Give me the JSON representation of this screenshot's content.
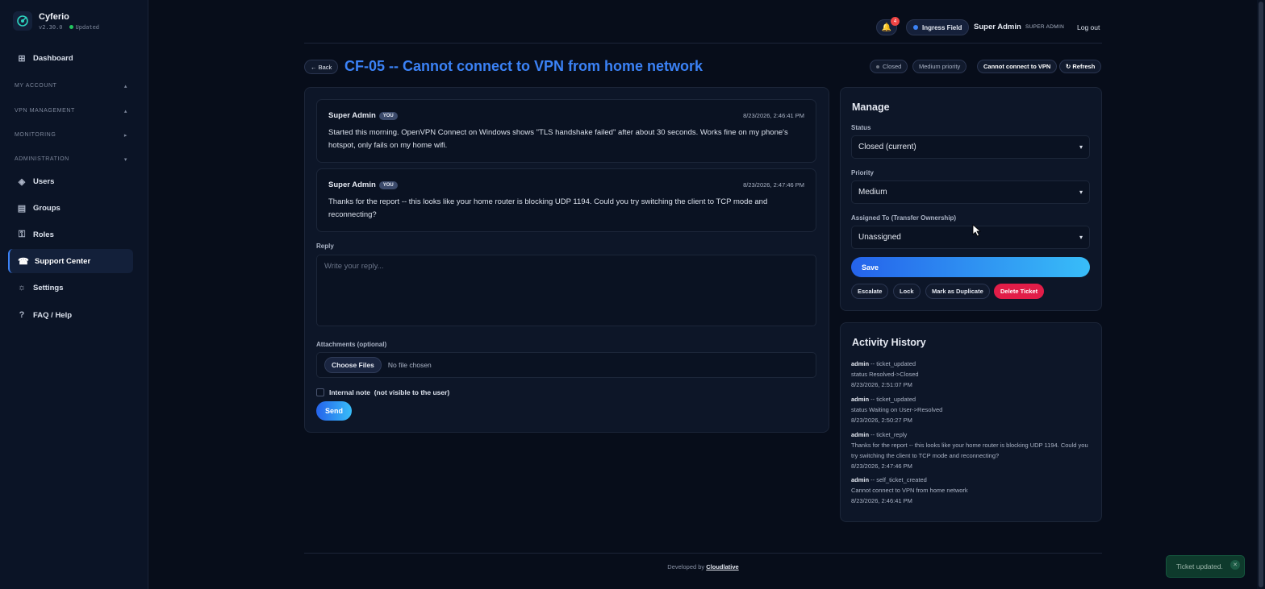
{
  "app": {
    "name": "Cyferio",
    "version": "v2.30.0",
    "status": "Updated"
  },
  "sidebar": {
    "dashboard": "Dashboard",
    "sections": {
      "my_account": "MY ACCOUNT",
      "vpn_management": "VPN MANAGEMENT",
      "monitoring": "MONITORING",
      "administration": "ADMINISTRATION"
    },
    "items": {
      "users": "Users",
      "groups": "Groups",
      "roles": "Roles",
      "support_center": "Support Center",
      "settings": "Settings",
      "faq": "FAQ / Help"
    }
  },
  "topbar": {
    "notification_count": "4",
    "workspace": "Ingress Field",
    "user_name": "Super Admin",
    "user_role": "SUPER ADMIN",
    "logout": "Log out"
  },
  "ticket": {
    "back_label": "← Back",
    "title": "CF-05 -- Cannot connect to VPN from home network",
    "pills": {
      "status": "Closed",
      "priority": "Medium priority",
      "subject": "Cannot connect to VPN",
      "refresh": "↻ Refresh"
    },
    "messages": [
      {
        "author": "Super Admin",
        "badge": "YOU",
        "time": "8/23/2026, 2:46:41 PM",
        "body": "Started this morning. OpenVPN Connect on Windows shows \"TLS handshake failed\" after about 30 seconds. Works fine on my phone's hotspot, only fails on my home wifi."
      },
      {
        "author": "Super Admin",
        "badge": "YOU",
        "time": "8/23/2026, 2:47:46 PM",
        "body": "Thanks for the report -- this looks like your home router is blocking UDP 1194. Could you try switching the client to TCP mode and reconnecting?"
      }
    ],
    "reply": {
      "label": "Reply",
      "placeholder": "Write your reply...",
      "attachments_label": "Attachments (optional)",
      "choose_files": "Choose Files",
      "no_file": "No file chosen",
      "internal_note": "Internal note  (not visible to the user)",
      "send": "Send"
    }
  },
  "manage": {
    "title": "Manage",
    "status_label": "Status",
    "status_value": "Closed (current)",
    "priority_label": "Priority",
    "priority_value": "Medium",
    "assigned_label": "Assigned To (Transfer Ownership)",
    "assigned_value": "Unassigned",
    "save": "Save",
    "actions": {
      "escalate": "Escalate",
      "lock": "Lock",
      "duplicate": "Mark as Duplicate",
      "delete": "Delete Ticket"
    }
  },
  "activity": {
    "title": "Activity History",
    "entries": [
      {
        "who": "admin",
        "action": " -- ticket_updated",
        "detail": "status Resolved->Closed",
        "time": "8/23/2026, 2:51:07 PM"
      },
      {
        "who": "admin",
        "action": " -- ticket_updated",
        "detail": "status Waiting on User->Resolved",
        "time": "8/23/2026, 2:50:27 PM"
      },
      {
        "who": "admin",
        "action": " -- ticket_reply",
        "detail": "Thanks for the report -- this looks like your home router is blocking UDP 1194. Could you try switching the client to TCP mode and reconnecting?",
        "time": "8/23/2026, 2:47:46 PM"
      },
      {
        "who": "admin",
        "action": " -- self_ticket_created",
        "detail": "Cannot connect to VPN from home network",
        "time": "8/23/2026, 2:46:41 PM"
      }
    ]
  },
  "footer": {
    "prefix": "Developed by ",
    "link": "Cloudlative"
  },
  "toast": {
    "message": "Ticket updated."
  },
  "colors": {
    "background": "#070d1a",
    "accent": "#3b82f6",
    "danger": "#e11d48",
    "success": "#22c55e"
  }
}
